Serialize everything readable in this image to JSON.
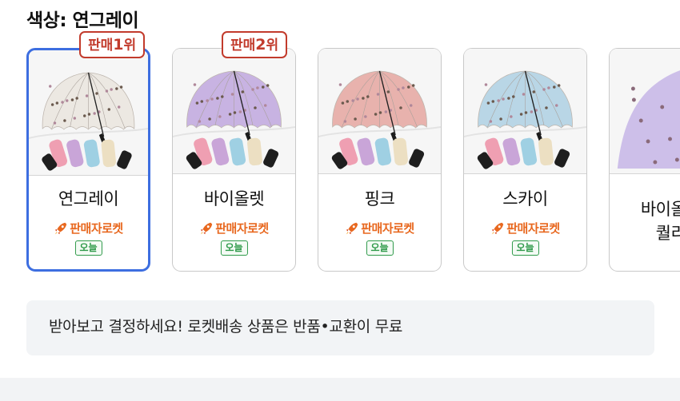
{
  "color_selector": {
    "title": "색상: 연그레이",
    "badges": [
      {
        "prefix": "판매",
        "rank": "1",
        "suffix": "위"
      },
      {
        "prefix": "판매",
        "rank": "2",
        "suffix": "위"
      }
    ],
    "options": [
      {
        "name": "연그레이",
        "delivery": "판매자로켓",
        "today": "오늘",
        "selected": true,
        "umbrella_color": "#ece8e2"
      },
      {
        "name": "바이올렛",
        "delivery": "판매자로켓",
        "today": "오늘",
        "selected": false,
        "umbrella_color": "#c8b3e2"
      },
      {
        "name": "핑크",
        "delivery": "판매자로켓",
        "today": "오늘",
        "selected": false,
        "umbrella_color": "#e8b2ad"
      },
      {
        "name": "스카이",
        "delivery": "판매자로켓",
        "today": "오늘",
        "selected": false,
        "umbrella_color": "#b9d6e6"
      },
      {
        "name": "바이올렛\n퀄리",
        "selected": false,
        "umbrella_color": "#cdbfe9"
      }
    ]
  },
  "notice": {
    "text": "받아보고 결정하세요! 로켓배송 상품은 반품•교환이 무료"
  },
  "colors": {
    "selected_border": "#3d6ee0",
    "rank_badge": "#c23b2c",
    "rocket_text": "#e8681f",
    "today_badge": "#2f9a4a",
    "notice_bg": "#f2f4f6"
  }
}
